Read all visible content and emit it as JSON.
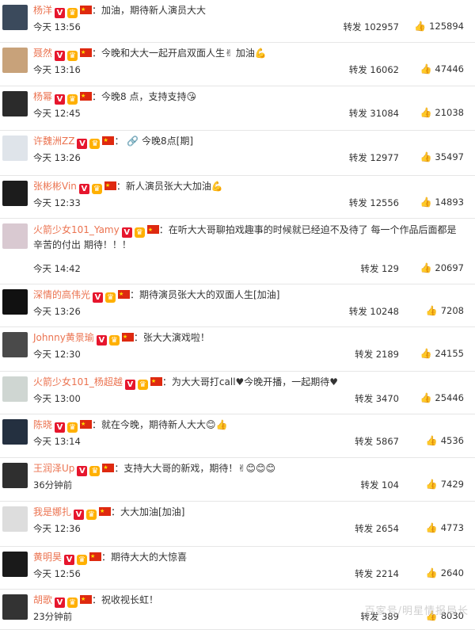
{
  "colors": {
    "name": "#eb7350",
    "vip": "#e6162d",
    "divider": "#e6e6e6"
  },
  "watermark": "百家号/明星情报局长",
  "comments": [
    {
      "name": "杨洋",
      "text": "：加油，期待新人演员大大",
      "time": "今天 13:56",
      "repost": "转发 102957",
      "likes": "125894"
    },
    {
      "name": "聂然",
      "text": "：今晚和大大一起开启双面人生✌ 加油💪",
      "time": "今天 13:16",
      "repost": "转发 16062",
      "likes": "47446"
    },
    {
      "name": "杨幂",
      "text": "：今晚8 点，支持支持😘",
      "time": "今天 12:45",
      "repost": "转发 31084",
      "likes": "21038"
    },
    {
      "name": "许魏洲ZZ",
      "text": "： 🔗 今晚8点[期]",
      "time": "今天 13:26",
      "repost": "转发 12977",
      "likes": "35497"
    },
    {
      "name": "张彬彬Vin",
      "text": "：新人演员张大大加油💪",
      "time": "今天 12:33",
      "repost": "转发 12556",
      "likes": "14893"
    },
    {
      "name": "火箭少女101_Yamy",
      "text": "：在听大大哥聊拍戏趣事的时候就已经迫不及待了 每一个作品后面都是辛苦的付出 期待！！！",
      "time": "今天 14:42",
      "repost": "转发 129",
      "likes": "20697"
    },
    {
      "name": "深情的高伟光",
      "text": "：期待演员张大大的双面人生[加油]",
      "time": "今天 13:26",
      "repost": "转发 10248",
      "likes": "7208"
    },
    {
      "name": "Johnny黄景瑜",
      "text": "：张大大演戏啦！",
      "time": "今天 12:30",
      "repost": "转发 2189",
      "likes": "24155"
    },
    {
      "name": "火箭少女101_杨超越",
      "text": "：为大大哥打call♥今晚开播，一起期待♥",
      "time": "今天 13:00",
      "repost": "转发 3470",
      "likes": "25446"
    },
    {
      "name": "陈晓",
      "text": "：就在今晚，期待新人大大😊👍",
      "time": "今天 13:14",
      "repost": "转发 5867",
      "likes": "4536"
    },
    {
      "name": "王润泽Up",
      "text": "：支持大大哥的新戏，期待！✌😊😊😊",
      "time": "36分钟前",
      "repost": "转发 104",
      "likes": "7429"
    },
    {
      "name": "我是娜扎",
      "text": "：大大加油[加油]",
      "time": "今天 12:36",
      "repost": "转发 2654",
      "likes": "4773"
    },
    {
      "name": "黄明昊",
      "text": "：期待大大的大惊喜",
      "time": "今天 12:56",
      "repost": "转发 2214",
      "likes": "2640"
    },
    {
      "name": "胡歌",
      "text": "：祝收视长虹！",
      "time": "23分钟前",
      "repost": "转发 389",
      "likes": "8030"
    }
  ]
}
